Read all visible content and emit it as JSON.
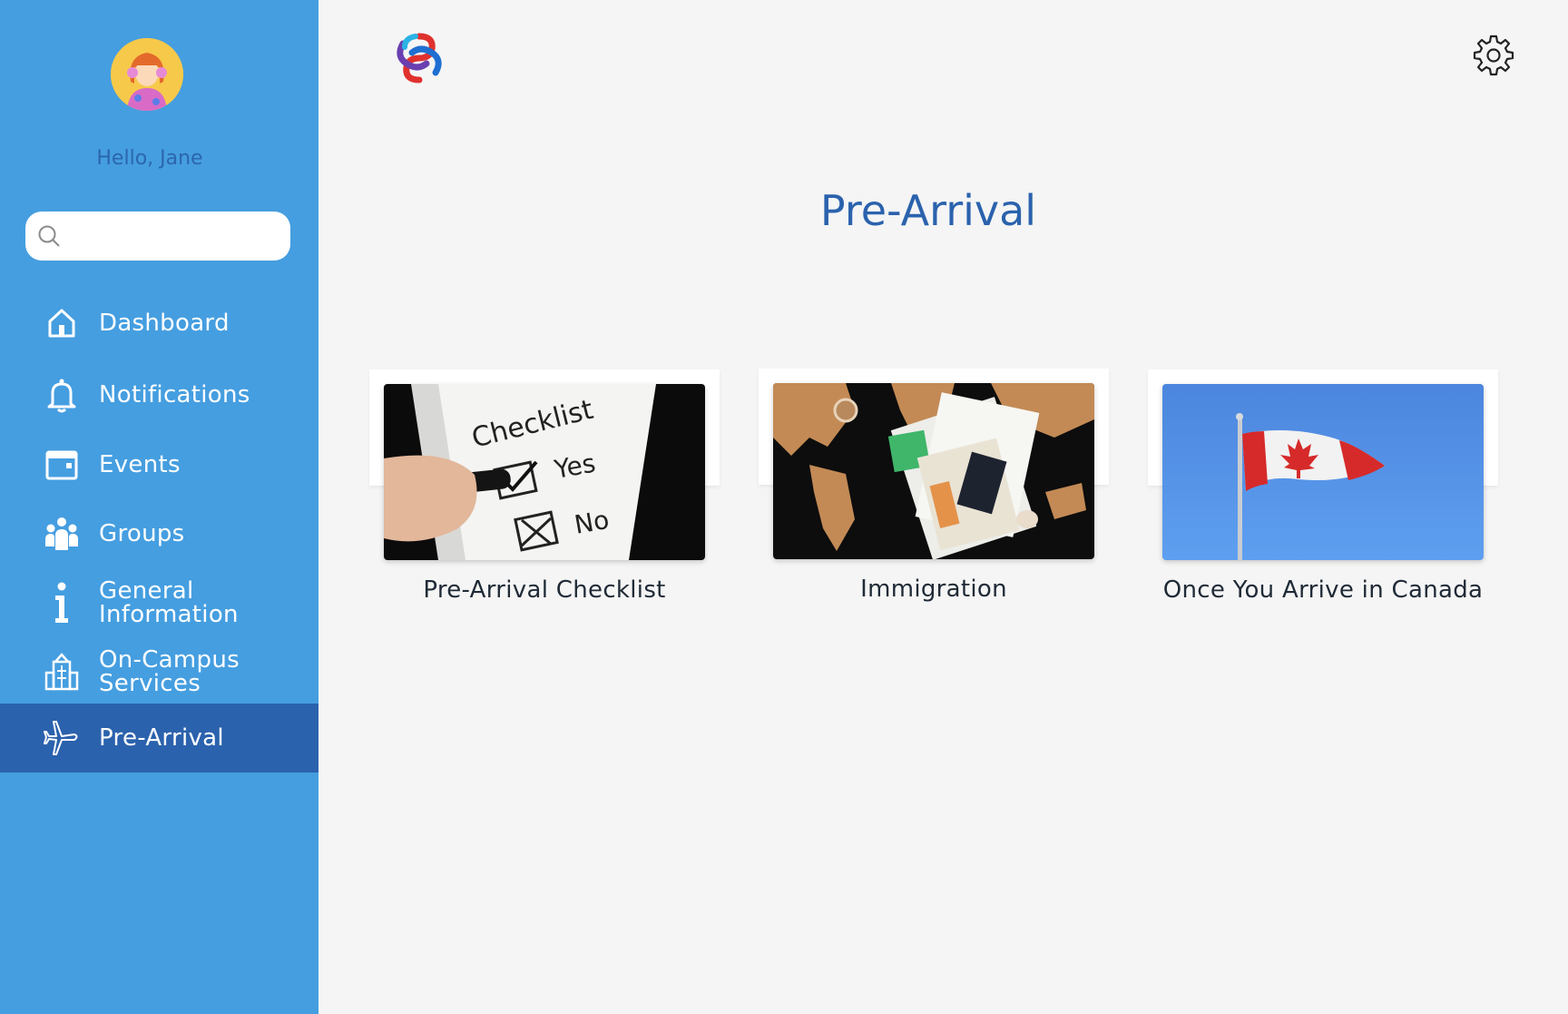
{
  "sidebar": {
    "greeting": "Hello, Jane",
    "search": {
      "value": "",
      "placeholder": ""
    },
    "items": [
      {
        "label": "Dashboard",
        "icon": "home-icon"
      },
      {
        "label": "Notifications",
        "icon": "bell-icon"
      },
      {
        "label": "Events",
        "icon": "calendar-icon"
      },
      {
        "label": "Groups",
        "icon": "people-icon"
      },
      {
        "label": "General\nInformation",
        "icon": "info-icon"
      },
      {
        "label": "On-Campus\nServices",
        "icon": "building-icon"
      },
      {
        "label": "Pre-Arrival",
        "icon": "airplane-icon",
        "active": true
      }
    ]
  },
  "main": {
    "title": "Pre-Arrival",
    "cards": [
      {
        "caption": "Pre-Arrival Checklist",
        "image": "checklist-photo"
      },
      {
        "caption": "Immigration",
        "image": "passport-map-photo"
      },
      {
        "caption": "Once You Arrive in Canada",
        "image": "canada-flag-photo"
      }
    ]
  },
  "colors": {
    "sidebar": "#459ee0",
    "sidebar_active": "#2b62ad",
    "title": "#2b62ad",
    "background": "#f5f5f5"
  }
}
